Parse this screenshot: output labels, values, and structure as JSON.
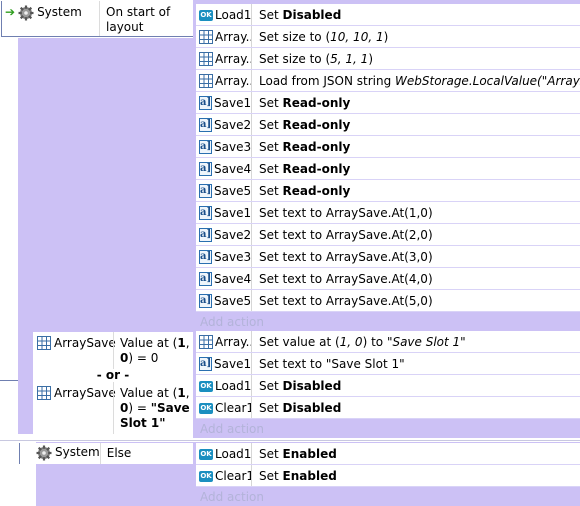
{
  "event1": {
    "object": "System",
    "condition": "On start of layout",
    "actions": [
      {
        "icon": "ok-icon",
        "object": "Load1",
        "prefix": "Set ",
        "bold": "Disabled",
        "rest": ""
      },
      {
        "icon": "array-icon",
        "object": "Array...",
        "prefix": "Set size to (",
        "italic": "10, 10, 1",
        "rest": ")"
      },
      {
        "icon": "array-icon",
        "object": "Array...",
        "prefix": "Set size to (",
        "italic": "5, 1, 1",
        "rest": ")"
      },
      {
        "icon": "array-icon",
        "object": "Array...",
        "prefix": "Load from JSON string ",
        "italic": "WebStorage.LocalValue(\"ArraySave\")",
        "rest": ""
      },
      {
        "icon": "text-icon",
        "object": "Save1",
        "prefix": "Set ",
        "bold": "Read-only",
        "rest": ""
      },
      {
        "icon": "text-icon",
        "object": "Save2",
        "prefix": "Set ",
        "bold": "Read-only",
        "rest": ""
      },
      {
        "icon": "text-icon",
        "object": "Save3",
        "prefix": "Set ",
        "bold": "Read-only",
        "rest": ""
      },
      {
        "icon": "text-icon",
        "object": "Save4",
        "prefix": "Set ",
        "bold": "Read-only",
        "rest": ""
      },
      {
        "icon": "text-icon",
        "object": "Save5",
        "prefix": "Set ",
        "bold": "Read-only",
        "rest": ""
      },
      {
        "icon": "text-icon",
        "object": "Save1",
        "prefix": "Set text to ArraySave.At(1,0)",
        "rest": ""
      },
      {
        "icon": "text-icon",
        "object": "Save2",
        "prefix": "Set text to ArraySave.At(2,0)",
        "rest": ""
      },
      {
        "icon": "text-icon",
        "object": "Save3",
        "prefix": "Set text to ArraySave.At(3,0)",
        "rest": ""
      },
      {
        "icon": "text-icon",
        "object": "Save4",
        "prefix": "Set text to ArraySave.At(4,0)",
        "rest": ""
      },
      {
        "icon": "text-icon",
        "object": "Save5",
        "prefix": "Set text to ArraySave.At(5,0)",
        "rest": ""
      }
    ],
    "add_action": "Add action"
  },
  "event2": {
    "cond1": {
      "object": "ArraySave",
      "text_a": "Value at (",
      "bold_a": "1",
      "text_b": ", ",
      "bold_b": "0",
      "text_c": ") = 0"
    },
    "or_label": "- or -",
    "cond2": {
      "object": "ArraySave",
      "text_a": "Value at (",
      "bold_a": "1",
      "text_b": ", ",
      "bold_b": "0",
      "text_c": ") = ",
      "bold_c": "\"Save Slot 1\""
    },
    "actions": [
      {
        "icon": "array-icon",
        "object": "Array...",
        "prefix": "Set value at (",
        "italic": "1, 0",
        "rest": ") to ",
        "italic2": "\"Save Slot 1\""
      },
      {
        "icon": "text-icon",
        "object": "Save1",
        "prefix": "Set text to \"Save Slot 1\"",
        "rest": ""
      },
      {
        "icon": "ok-icon",
        "object": "Load1",
        "prefix": "Set ",
        "bold": "Disabled",
        "rest": ""
      },
      {
        "icon": "ok-icon",
        "object": "Clear1",
        "prefix": "Set ",
        "bold": "Disabled",
        "rest": ""
      }
    ],
    "add_action": "Add action"
  },
  "event3": {
    "object": "System",
    "condition": "Else",
    "actions": [
      {
        "icon": "ok-icon",
        "object": "Load1",
        "prefix": "Set ",
        "bold": "Enabled",
        "rest": ""
      },
      {
        "icon": "ok-icon",
        "object": "Clear1",
        "prefix": "Set ",
        "bold": "Enabled",
        "rest": ""
      }
    ],
    "add_action": "Add action"
  },
  "icon_ok_text": "OK",
  "icon_txt_text": "a]",
  "colors": {
    "event_bg": "#ccc1f5",
    "row_sep": "#e8e8f5",
    "add_action": "#b3b3d9",
    "tree_line": "#6f7fb0"
  }
}
